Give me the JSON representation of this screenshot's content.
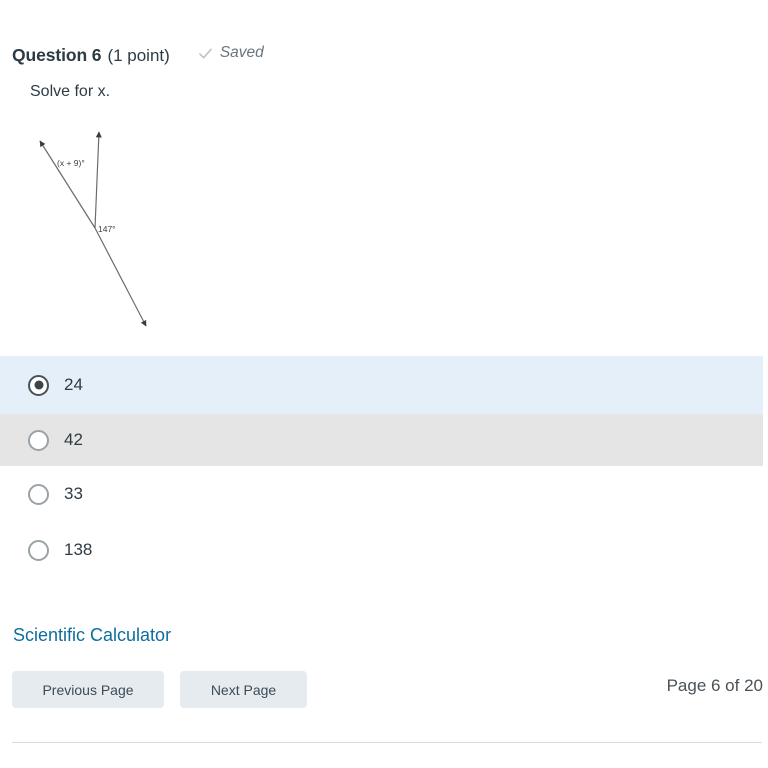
{
  "question": {
    "title": "Question 6",
    "points": "(1 point)",
    "save_status": "Saved",
    "save_icon": "check-icon",
    "prompt": "Solve for x."
  },
  "figure": {
    "type": "geometry-angle-diagram",
    "labels": {
      "unknown_angle": "(x + 9)°",
      "known_angle": "147°"
    },
    "stroke_color": "#6b6b6b"
  },
  "options": [
    {
      "label": "24",
      "selected": true,
      "state": "selected"
    },
    {
      "label": "42",
      "selected": false,
      "state": "hovered"
    },
    {
      "label": "33",
      "selected": false,
      "state": "normal"
    },
    {
      "label": "138",
      "selected": false,
      "state": "normal"
    }
  ],
  "tools": {
    "calculator_link": "Scientific Calculator"
  },
  "footer": {
    "previous_label": "Previous Page",
    "next_label": "Next Page",
    "page_indicator": "Page 6 of 20"
  },
  "colors": {
    "selected_row": "#e4eff9",
    "hovered_row": "#e5e5e5",
    "link": "#0d6e9e",
    "button_bg": "#e6ebf0",
    "text": "#2d3b45"
  }
}
